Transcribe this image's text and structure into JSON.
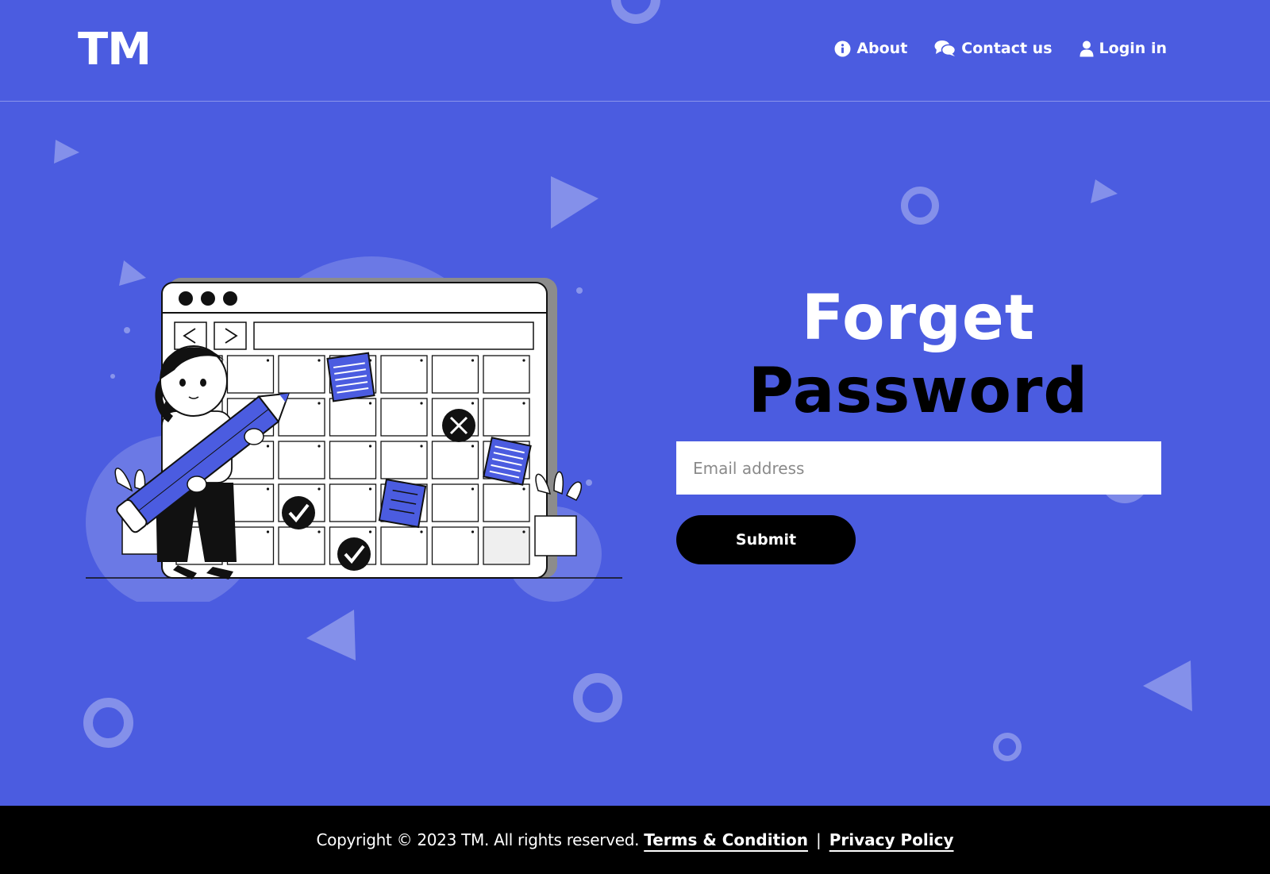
{
  "brand": {
    "logo": "TM"
  },
  "nav": {
    "about": "About",
    "contact": "Contact us",
    "login": "Login in"
  },
  "form": {
    "title_line1": "Forget",
    "title_line2": "Password",
    "email_placeholder": "Email address",
    "email_value": "",
    "submit_label": "Submit"
  },
  "footer": {
    "copyright": "Copyright ©  2023 TM. All rights reserved.",
    "terms": "Terms & Condition",
    "separator": "|",
    "privacy": "Privacy Policy"
  },
  "colors": {
    "background": "#4b5ce0",
    "accent_dark": "#000000",
    "text_light": "#ffffff"
  },
  "icons": {
    "about": "info-circle-icon",
    "contact": "chat-bubbles-icon",
    "login": "user-icon"
  }
}
